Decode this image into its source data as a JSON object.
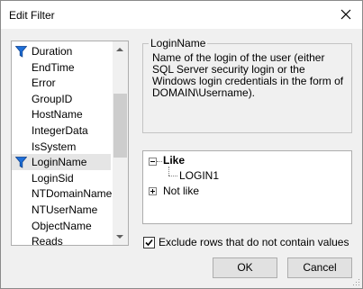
{
  "window": {
    "title": "Edit Filter"
  },
  "fields": [
    {
      "label": "Duration",
      "filtered": true,
      "selected": false
    },
    {
      "label": "EndTime",
      "filtered": false,
      "selected": false
    },
    {
      "label": "Error",
      "filtered": false,
      "selected": false
    },
    {
      "label": "GroupID",
      "filtered": false,
      "selected": false
    },
    {
      "label": "HostName",
      "filtered": false,
      "selected": false
    },
    {
      "label": "IntegerData",
      "filtered": false,
      "selected": false
    },
    {
      "label": "IsSystem",
      "filtered": false,
      "selected": false
    },
    {
      "label": "LoginName",
      "filtered": true,
      "selected": true
    },
    {
      "label": "LoginSid",
      "filtered": false,
      "selected": false
    },
    {
      "label": "NTDomainName",
      "filtered": false,
      "selected": false
    },
    {
      "label": "NTUserName",
      "filtered": false,
      "selected": false
    },
    {
      "label": "ObjectName",
      "filtered": false,
      "selected": false
    },
    {
      "label": "Reads",
      "filtered": false,
      "selected": false
    }
  ],
  "description": {
    "title": "LoginName",
    "text": "Name of the login of the user (either SQL Server security login or the Windows login credentials in the form of DOMAIN\\Username)."
  },
  "tree": {
    "like_label": "Like",
    "like_value": "LOGIN1",
    "not_like_label": "Not like"
  },
  "exclude": {
    "label": "Exclude rows that do not contain values",
    "checked": true
  },
  "buttons": {
    "ok": "OK",
    "cancel": "Cancel"
  },
  "colors": {
    "filter_icon": "#1e6fd9"
  }
}
